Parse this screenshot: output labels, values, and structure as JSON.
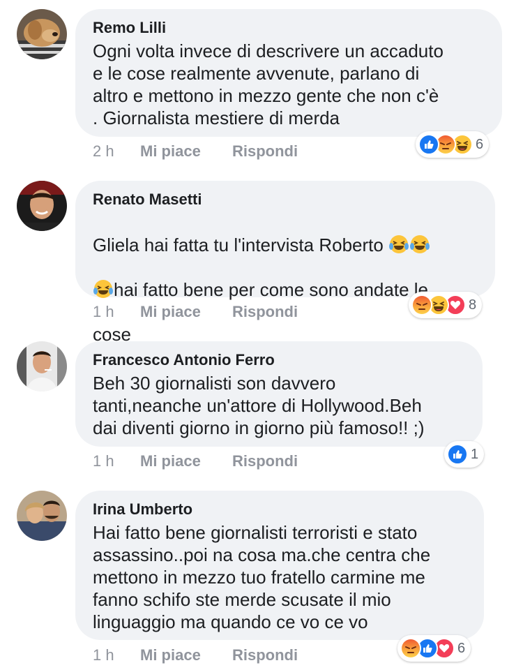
{
  "comments": [
    {
      "author": "Remo Lilli",
      "text": "Ogni volta invece di descrivere un accaduto\ne le cose realmente avvenute, parlano di\naltro e mettono in mezzo gente che non c'è\n. Giornalista mestiere di merda",
      "time": "2 h",
      "like_label": "Mi piace",
      "reply_label": "Rispondi",
      "reactions": [
        "like-icon",
        "angry-icon",
        "haha-icon"
      ],
      "reaction_count": "6"
    },
    {
      "author": "Renato Masetti",
      "text_line1": "Gliela hai fatta tu l'intervista Roberto",
      "text_line2": "hai fatto bene per come sono andate le",
      "text_line3": "cose",
      "time": "1 h",
      "like_label": "Mi piace",
      "reply_label": "Rispondi",
      "reactions": [
        "angry-icon",
        "haha-icon",
        "love-icon"
      ],
      "reaction_count": "8"
    },
    {
      "author": "Francesco Antonio Ferro",
      "text": "Beh 30 giornalisti son davvero\ntanti,neanche un'attore di Hollywood.Beh\ndai diventi giorno in giorno più famoso!! ;)",
      "time": "1 h",
      "like_label": "Mi piace",
      "reply_label": "Rispondi",
      "reactions": [
        "like-icon"
      ],
      "reaction_count": "1"
    },
    {
      "author": "Irina Umberto",
      "text": "Hai fatto bene giornalisti terroristi e stato\nassassino..poi na cosa ma.che centra che\nmettono in mezzo tuo fratello carmine me\nfanno schifo ste merde scusate il mio\nlinguaggio ma quando ce vo ce vo",
      "time": "1 h",
      "like_label": "Mi piace",
      "reply_label": "Rispondi",
      "reactions": [
        "angry-icon",
        "like-icon",
        "love-icon"
      ],
      "reaction_count": "6"
    }
  ],
  "colors": {
    "bubble": "#f0f2f5",
    "meta": "#90949c",
    "like_blue": "#1877f2",
    "love_red": "#f33e58",
    "emoji_yellow": "#fcc53b",
    "angry_orange": "#f26a2c"
  }
}
